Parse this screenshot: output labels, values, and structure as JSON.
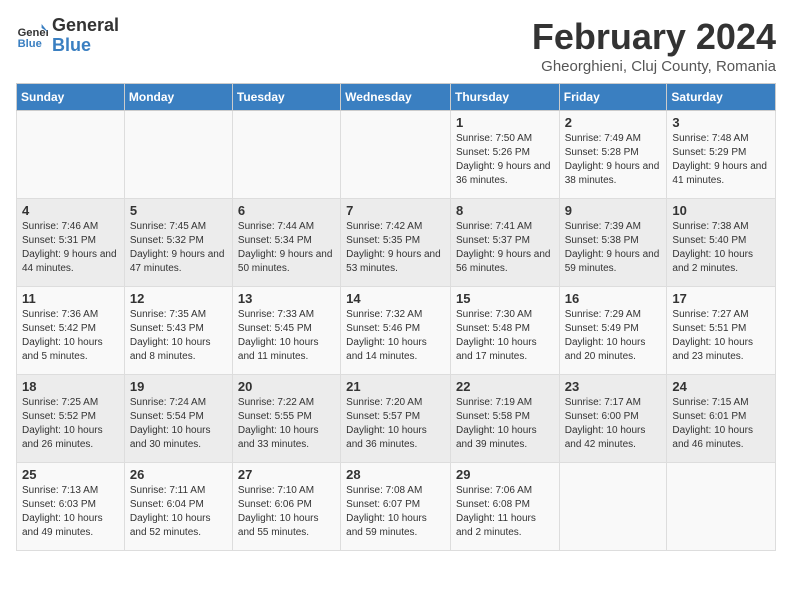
{
  "header": {
    "logo_line1": "General",
    "logo_line2": "Blue",
    "month_title": "February 2024",
    "location": "Gheorghieni, Cluj County, Romania"
  },
  "days_of_week": [
    "Sunday",
    "Monday",
    "Tuesday",
    "Wednesday",
    "Thursday",
    "Friday",
    "Saturday"
  ],
  "weeks": [
    [
      {
        "day": "",
        "info": ""
      },
      {
        "day": "",
        "info": ""
      },
      {
        "day": "",
        "info": ""
      },
      {
        "day": "",
        "info": ""
      },
      {
        "day": "1",
        "info": "Sunrise: 7:50 AM\nSunset: 5:26 PM\nDaylight: 9 hours and 36 minutes."
      },
      {
        "day": "2",
        "info": "Sunrise: 7:49 AM\nSunset: 5:28 PM\nDaylight: 9 hours and 38 minutes."
      },
      {
        "day": "3",
        "info": "Sunrise: 7:48 AM\nSunset: 5:29 PM\nDaylight: 9 hours and 41 minutes."
      }
    ],
    [
      {
        "day": "4",
        "info": "Sunrise: 7:46 AM\nSunset: 5:31 PM\nDaylight: 9 hours and 44 minutes."
      },
      {
        "day": "5",
        "info": "Sunrise: 7:45 AM\nSunset: 5:32 PM\nDaylight: 9 hours and 47 minutes."
      },
      {
        "day": "6",
        "info": "Sunrise: 7:44 AM\nSunset: 5:34 PM\nDaylight: 9 hours and 50 minutes."
      },
      {
        "day": "7",
        "info": "Sunrise: 7:42 AM\nSunset: 5:35 PM\nDaylight: 9 hours and 53 minutes."
      },
      {
        "day": "8",
        "info": "Sunrise: 7:41 AM\nSunset: 5:37 PM\nDaylight: 9 hours and 56 minutes."
      },
      {
        "day": "9",
        "info": "Sunrise: 7:39 AM\nSunset: 5:38 PM\nDaylight: 9 hours and 59 minutes."
      },
      {
        "day": "10",
        "info": "Sunrise: 7:38 AM\nSunset: 5:40 PM\nDaylight: 10 hours and 2 minutes."
      }
    ],
    [
      {
        "day": "11",
        "info": "Sunrise: 7:36 AM\nSunset: 5:42 PM\nDaylight: 10 hours and 5 minutes."
      },
      {
        "day": "12",
        "info": "Sunrise: 7:35 AM\nSunset: 5:43 PM\nDaylight: 10 hours and 8 minutes."
      },
      {
        "day": "13",
        "info": "Sunrise: 7:33 AM\nSunset: 5:45 PM\nDaylight: 10 hours and 11 minutes."
      },
      {
        "day": "14",
        "info": "Sunrise: 7:32 AM\nSunset: 5:46 PM\nDaylight: 10 hours and 14 minutes."
      },
      {
        "day": "15",
        "info": "Sunrise: 7:30 AM\nSunset: 5:48 PM\nDaylight: 10 hours and 17 minutes."
      },
      {
        "day": "16",
        "info": "Sunrise: 7:29 AM\nSunset: 5:49 PM\nDaylight: 10 hours and 20 minutes."
      },
      {
        "day": "17",
        "info": "Sunrise: 7:27 AM\nSunset: 5:51 PM\nDaylight: 10 hours and 23 minutes."
      }
    ],
    [
      {
        "day": "18",
        "info": "Sunrise: 7:25 AM\nSunset: 5:52 PM\nDaylight: 10 hours and 26 minutes."
      },
      {
        "day": "19",
        "info": "Sunrise: 7:24 AM\nSunset: 5:54 PM\nDaylight: 10 hours and 30 minutes."
      },
      {
        "day": "20",
        "info": "Sunrise: 7:22 AM\nSunset: 5:55 PM\nDaylight: 10 hours and 33 minutes."
      },
      {
        "day": "21",
        "info": "Sunrise: 7:20 AM\nSunset: 5:57 PM\nDaylight: 10 hours and 36 minutes."
      },
      {
        "day": "22",
        "info": "Sunrise: 7:19 AM\nSunset: 5:58 PM\nDaylight: 10 hours and 39 minutes."
      },
      {
        "day": "23",
        "info": "Sunrise: 7:17 AM\nSunset: 6:00 PM\nDaylight: 10 hours and 42 minutes."
      },
      {
        "day": "24",
        "info": "Sunrise: 7:15 AM\nSunset: 6:01 PM\nDaylight: 10 hours and 46 minutes."
      }
    ],
    [
      {
        "day": "25",
        "info": "Sunrise: 7:13 AM\nSunset: 6:03 PM\nDaylight: 10 hours and 49 minutes."
      },
      {
        "day": "26",
        "info": "Sunrise: 7:11 AM\nSunset: 6:04 PM\nDaylight: 10 hours and 52 minutes."
      },
      {
        "day": "27",
        "info": "Sunrise: 7:10 AM\nSunset: 6:06 PM\nDaylight: 10 hours and 55 minutes."
      },
      {
        "day": "28",
        "info": "Sunrise: 7:08 AM\nSunset: 6:07 PM\nDaylight: 10 hours and 59 minutes."
      },
      {
        "day": "29",
        "info": "Sunrise: 7:06 AM\nSunset: 6:08 PM\nDaylight: 11 hours and 2 minutes."
      },
      {
        "day": "",
        "info": ""
      },
      {
        "day": "",
        "info": ""
      }
    ]
  ]
}
